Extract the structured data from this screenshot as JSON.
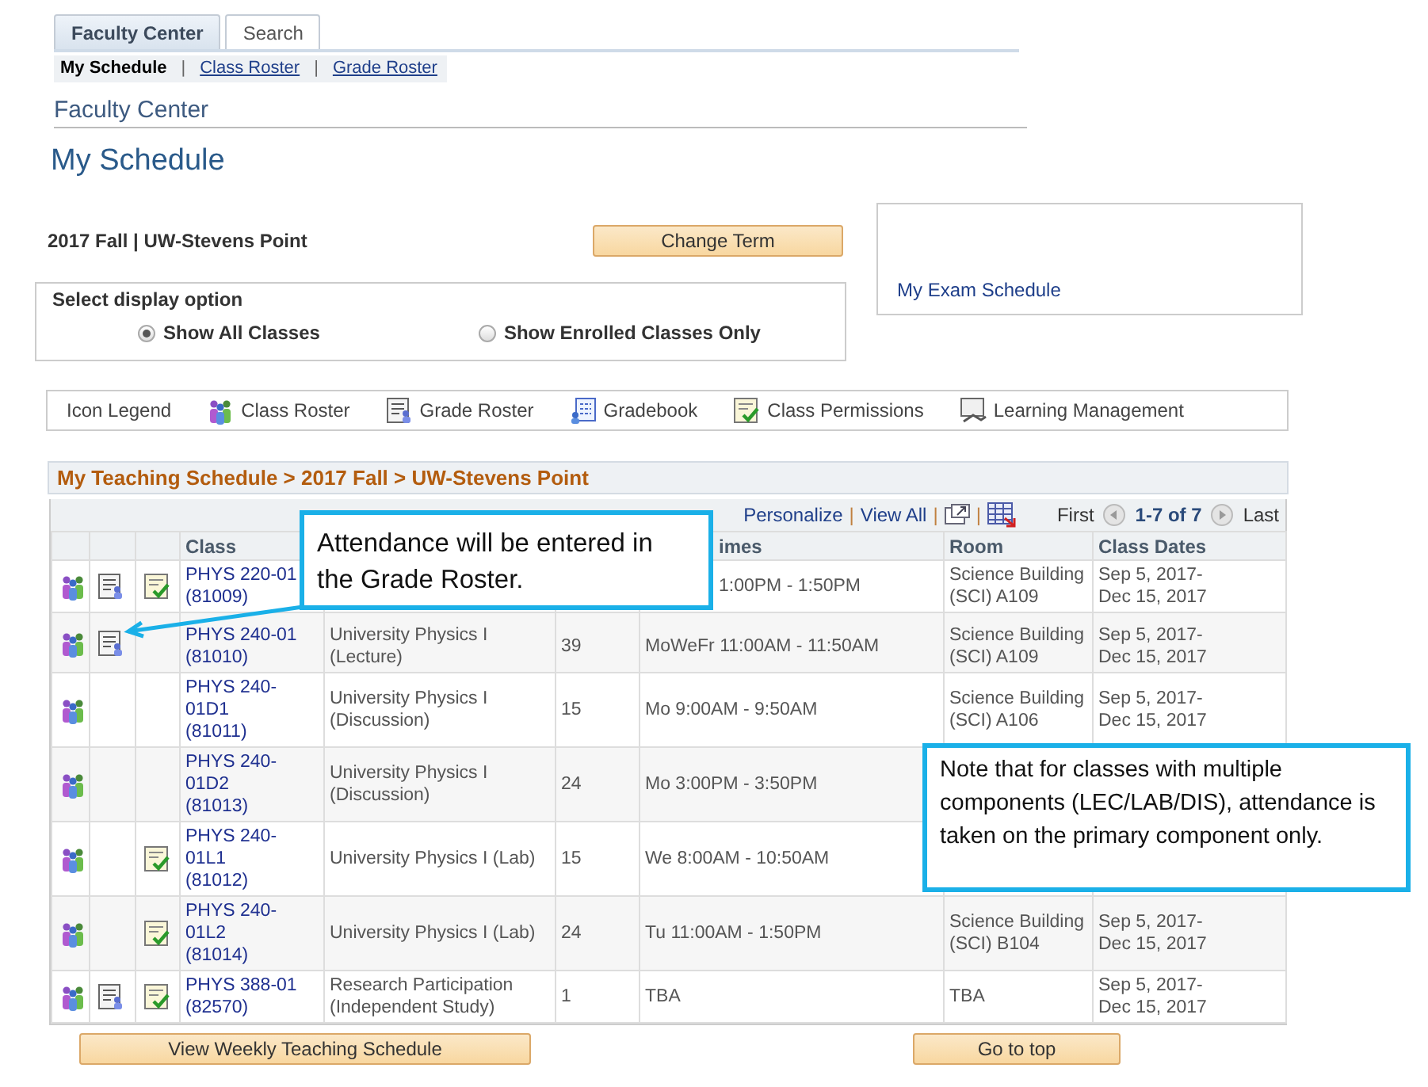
{
  "tabs": [
    {
      "label": "Faculty Center",
      "selected": true
    },
    {
      "label": "Search",
      "selected": false
    }
  ],
  "subnav": [
    {
      "kind": "item",
      "label": "My Schedule",
      "selected": true
    },
    {
      "kind": "separator",
      "label": "|"
    },
    {
      "kind": "item",
      "label": "Class Roster",
      "selected": false
    },
    {
      "kind": "separator",
      "label": "|"
    },
    {
      "kind": "item",
      "label": "Grade Roster",
      "selected": false
    }
  ],
  "section_title": "Faculty Center",
  "page_title": "My Schedule",
  "term": "2017 Fall | UW-Stevens Point",
  "change_term_button": "Change Term",
  "exam_link": "My Exam Schedule",
  "display_option": {
    "title": "Select display option",
    "options": [
      {
        "label": "Show All Classes",
        "selected": true
      },
      {
        "label": "Show Enrolled Classes Only",
        "selected": false
      }
    ]
  },
  "legend": {
    "title": "Icon Legend",
    "items": [
      {
        "kind": "roster",
        "label": "Class Roster"
      },
      {
        "kind": "grade",
        "label": "Grade Roster"
      },
      {
        "kind": "gradebook",
        "label": "Gradebook"
      },
      {
        "kind": "permissions",
        "label": "Class Permissions"
      },
      {
        "kind": "lms",
        "label": "Learning Management"
      }
    ]
  },
  "schedule": {
    "title": "My Teaching Schedule > 2017 Fall > UW-Stevens Point",
    "toolbar": [
      {
        "kind": "link",
        "label": "Personalize"
      },
      {
        "kind": "separator",
        "label": "|"
      },
      {
        "kind": "link",
        "label": "View All"
      },
      {
        "kind": "separator",
        "label": "|"
      },
      {
        "kind": "zoom"
      },
      {
        "kind": "separator",
        "label": "|"
      },
      {
        "kind": "download"
      }
    ],
    "pager": {
      "first": "First",
      "range": "1-7 of 7",
      "last": "Last"
    },
    "columns": [
      {},
      {},
      {},
      {
        "label": "Class"
      },
      {},
      {},
      {
        "label": "imes"
      },
      {
        "label": "Room"
      },
      {
        "label": "Class Dates"
      }
    ],
    "rows": [
      {
        "roster": true,
        "grade_roster": true,
        "permissions": true,
        "class": "PHYS 220-01",
        "class_number": "(81009)",
        "times": "1:00PM - 1:50PM",
        "room": "Science Building (SCI) A109",
        "dates": "Sep 5, 2017- Dec 15, 2017"
      },
      {
        "roster": true,
        "grade_roster": true,
        "permissions": false,
        "class": "PHYS 240-01",
        "class_number": "(81010)",
        "title": "University Physics I (Lecture)",
        "enrolled": "39",
        "times": "MoWeFr 11:00AM - 11:50AM",
        "room": "Science Building (SCI) A109",
        "dates": "Sep 5, 2017- Dec 15, 2017"
      },
      {
        "roster": true,
        "grade_roster": false,
        "permissions": false,
        "class": "PHYS 240-01D1",
        "class_number": "(81011)",
        "title": "University Physics I (Discussion)",
        "enrolled": "15",
        "times": "Mo 9:00AM - 9:50AM",
        "room": "Science Building (SCI) A106",
        "dates": "Sep 5, 2017- Dec 15, 2017"
      },
      {
        "roster": true,
        "grade_roster": false,
        "permissions": false,
        "class": "PHYS 240-01D2",
        "class_number": "(81013)",
        "title": "University Physics I (Discussion)",
        "enrolled": "24",
        "times": "Mo 3:00PM - 3:50PM"
      },
      {
        "roster": true,
        "grade_roster": false,
        "permissions": true,
        "class": "PHYS 240-01L1",
        "class_number": "(81012)",
        "title": "University Physics I (Lab)",
        "enrolled": "15",
        "times": "We 8:00AM - 10:50AM"
      },
      {
        "roster": true,
        "grade_roster": false,
        "permissions": true,
        "class": "PHYS 240-01L2",
        "class_number": "(81014)",
        "title": "University Physics I (Lab)",
        "enrolled": "24",
        "times": "Tu 11:00AM - 1:50PM",
        "room": "Science Building (SCI) B104",
        "dates": "Sep 5, 2017- Dec 15, 2017"
      },
      {
        "roster": true,
        "grade_roster": true,
        "permissions": true,
        "class": "PHYS 388-01",
        "class_number": "(82570)",
        "title": "Research Participation (Independent Study)",
        "enrolled": "1",
        "times": "TBA",
        "room": "TBA",
        "dates": "Sep 5, 2017- Dec 15, 2017"
      }
    ]
  },
  "buttons": [
    {
      "kind": "weekly",
      "label": "View Weekly Teaching Schedule"
    },
    {
      "kind": "top",
      "label": "Go to top"
    }
  ],
  "callouts": [
    {
      "kind": "arrow",
      "text": "Attendance will be entered in the Grade Roster."
    },
    {
      "kind": "plain",
      "text": "Note that for classes with multiple components (LEC/LAB/DIS), attendance is taken on the primary component only."
    }
  ]
}
